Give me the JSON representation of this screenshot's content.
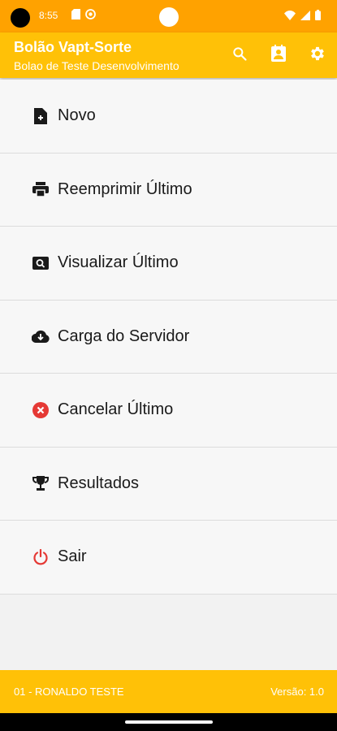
{
  "status_bar": {
    "time": "8:55",
    "left_icons": [
      "sd-card-icon",
      "notification-icon"
    ],
    "right_icons": [
      "wifi-icon",
      "signal-icon",
      "battery-icon"
    ]
  },
  "app_bar": {
    "title": "Bolão Vapt-Sorte",
    "subtitle": "Bolao de Teste Desenvolvimento",
    "actions": [
      "search-icon",
      "contact-card-icon",
      "settings-icon"
    ]
  },
  "menu": {
    "items": [
      {
        "label": "Novo",
        "icon": "new-file-icon",
        "color": "#1a1a1a"
      },
      {
        "label": "Reemprimir Último",
        "icon": "printer-icon",
        "color": "#1a1a1a"
      },
      {
        "label": "Visualizar Último",
        "icon": "preview-icon",
        "color": "#1a1a1a"
      },
      {
        "label": "Carga do Servidor",
        "icon": "cloud-download-icon",
        "color": "#1a1a1a"
      },
      {
        "label": "Cancelar Último",
        "icon": "cancel-icon",
        "color": "#e53935"
      },
      {
        "label": "Resultados",
        "icon": "trophy-icon",
        "color": "#1a1a1a"
      },
      {
        "label": "Sair",
        "icon": "power-icon",
        "color": "#e53935"
      }
    ]
  },
  "footer": {
    "user": "01 - RONALDO  TESTE",
    "version": "Versão: 1.0"
  },
  "colors": {
    "status_bar": "#ffa200",
    "app_bar": "#ffc107",
    "accent_red": "#e53935"
  }
}
